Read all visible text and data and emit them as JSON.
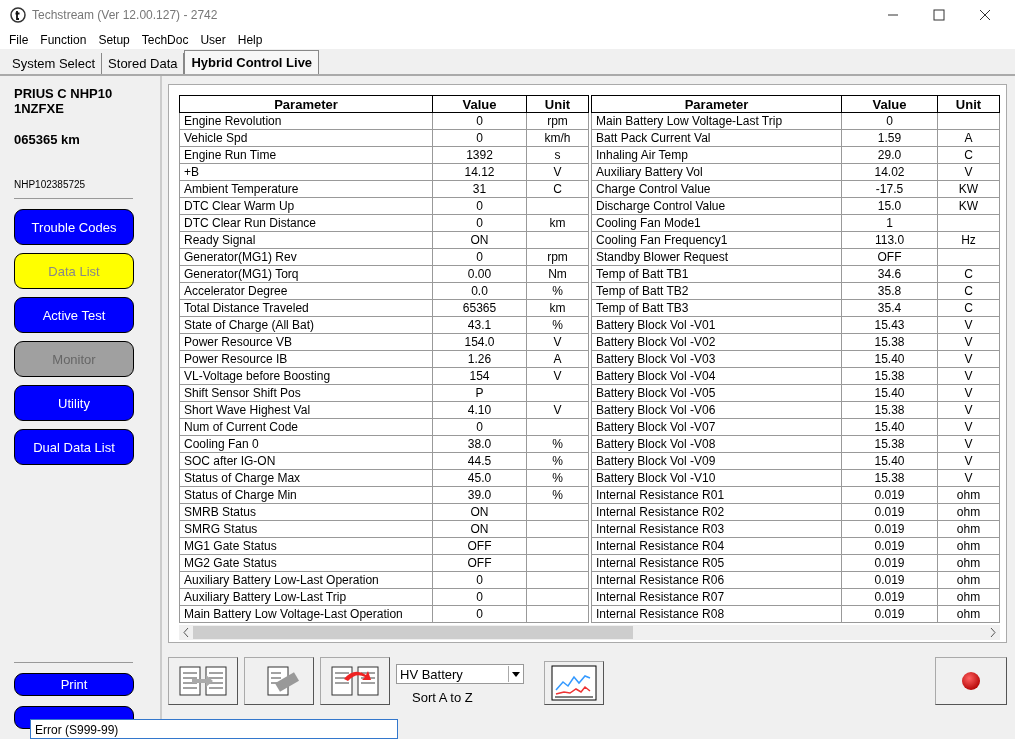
{
  "window": {
    "title": "Techstream (Ver 12.00.127) - 2742"
  },
  "menu": [
    "File",
    "Function",
    "Setup",
    "TechDoc",
    "User",
    "Help"
  ],
  "tabs": [
    {
      "label": "System Select",
      "selected": false
    },
    {
      "label": "Stored Data",
      "selected": false
    },
    {
      "label": "Hybrid Control Live",
      "selected": true
    }
  ],
  "vehicle": {
    "model": "PRIUS C NHP10",
    "engine": "1NZFXE",
    "odometer": "065365 km",
    "vin": "NHP102385725"
  },
  "nav_buttons": [
    {
      "label": "Trouble Codes",
      "selected": false,
      "disabled": false
    },
    {
      "label": "Data List",
      "selected": true,
      "disabled": false
    },
    {
      "label": "Active Test",
      "selected": false,
      "disabled": false
    },
    {
      "label": "Monitor",
      "selected": false,
      "disabled": true
    },
    {
      "label": "Utility",
      "selected": false,
      "disabled": false
    },
    {
      "label": "Dual Data List",
      "selected": false,
      "disabled": false
    }
  ],
  "print_button": "Print",
  "tables": [
    {
      "columns": [
        "Parameter",
        "Value",
        "Unit"
      ],
      "rows": [
        [
          "Engine Revolution",
          "0",
          "rpm"
        ],
        [
          "Vehicle Spd",
          "0",
          "km/h"
        ],
        [
          "Engine Run Time",
          "1392",
          "s"
        ],
        [
          "+B",
          "14.12",
          "V"
        ],
        [
          "Ambient Temperature",
          "31",
          "C"
        ],
        [
          "DTC Clear Warm Up",
          "0",
          ""
        ],
        [
          "DTC Clear Run Distance",
          "0",
          "km"
        ],
        [
          "Ready Signal",
          "ON",
          ""
        ],
        [
          "Generator(MG1) Rev",
          "0",
          "rpm"
        ],
        [
          "Generator(MG1) Torq",
          "0.00",
          "Nm"
        ],
        [
          "Accelerator Degree",
          "0.0",
          "%"
        ],
        [
          "Total Distance Traveled",
          "65365",
          "km"
        ],
        [
          "State of Charge (All Bat)",
          "43.1",
          "%"
        ],
        [
          "Power Resource VB",
          "154.0",
          "V"
        ],
        [
          "Power Resource IB",
          "1.26",
          "A"
        ],
        [
          "VL-Voltage before Boosting",
          "154",
          "V"
        ],
        [
          "Shift Sensor Shift Pos",
          "P",
          ""
        ],
        [
          "Short Wave Highest Val",
          "4.10",
          "V"
        ],
        [
          "Num of Current Code",
          "0",
          ""
        ],
        [
          "Cooling Fan 0",
          "38.0",
          "%"
        ],
        [
          "SOC after IG-ON",
          "44.5",
          "%"
        ],
        [
          "Status of Charge Max",
          "45.0",
          "%"
        ],
        [
          "Status of Charge Min",
          "39.0",
          "%"
        ],
        [
          "SMRB Status",
          "ON",
          ""
        ],
        [
          "SMRG Status",
          "ON",
          ""
        ],
        [
          "MG1 Gate Status",
          "OFF",
          ""
        ],
        [
          "MG2 Gate Status",
          "OFF",
          ""
        ],
        [
          "Auxiliary Battery Low-Last Operation",
          "0",
          ""
        ],
        [
          "Auxiliary Battery Low-Last Trip",
          "0",
          ""
        ],
        [
          "Main Battery Low Voltage-Last Operation",
          "0",
          ""
        ]
      ]
    },
    {
      "columns": [
        "Parameter",
        "Value",
        "Unit"
      ],
      "rows": [
        [
          "Main Battery Low Voltage-Last Trip",
          "0",
          ""
        ],
        [
          "Batt Pack Current Val",
          "1.59",
          "A"
        ],
        [
          "Inhaling Air Temp",
          "29.0",
          "C"
        ],
        [
          "Auxiliary Battery Vol",
          "14.02",
          "V"
        ],
        [
          "Charge Control Value",
          "-17.5",
          "KW"
        ],
        [
          "Discharge Control Value",
          "15.0",
          "KW"
        ],
        [
          "Cooling Fan Mode1",
          "1",
          ""
        ],
        [
          "Cooling Fan Frequency1",
          "113.0",
          "Hz"
        ],
        [
          "Standby Blower Request",
          "OFF",
          ""
        ],
        [
          "Temp of Batt TB1",
          "34.6",
          "C"
        ],
        [
          "Temp of Batt TB2",
          "35.8",
          "C"
        ],
        [
          "Temp of Batt TB3",
          "35.4",
          "C"
        ],
        [
          "Battery Block Vol -V01",
          "15.43",
          "V"
        ],
        [
          "Battery Block Vol -V02",
          "15.38",
          "V"
        ],
        [
          "Battery Block Vol -V03",
          "15.40",
          "V"
        ],
        [
          "Battery Block Vol -V04",
          "15.38",
          "V"
        ],
        [
          "Battery Block Vol -V05",
          "15.40",
          "V"
        ],
        [
          "Battery Block Vol -V06",
          "15.38",
          "V"
        ],
        [
          "Battery Block Vol -V07",
          "15.40",
          "V"
        ],
        [
          "Battery Block Vol -V08",
          "15.38",
          "V"
        ],
        [
          "Battery Block Vol -V09",
          "15.40",
          "V"
        ],
        [
          "Battery Block Vol -V10",
          "15.38",
          "V"
        ],
        [
          "Internal Resistance R01",
          "0.019",
          "ohm"
        ],
        [
          "Internal Resistance R02",
          "0.019",
          "ohm"
        ],
        [
          "Internal Resistance R03",
          "0.019",
          "ohm"
        ],
        [
          "Internal Resistance R04",
          "0.019",
          "ohm"
        ],
        [
          "Internal Resistance R05",
          "0.019",
          "ohm"
        ],
        [
          "Internal Resistance R06",
          "0.019",
          "ohm"
        ],
        [
          "Internal Resistance R07",
          "0.019",
          "ohm"
        ],
        [
          "Internal Resistance R08",
          "0.019",
          "ohm"
        ]
      ]
    }
  ],
  "toolbar": {
    "dropdown": "HV Battery",
    "sort_label": "Sort A to Z"
  },
  "tooltip": "Error (S999-99)"
}
